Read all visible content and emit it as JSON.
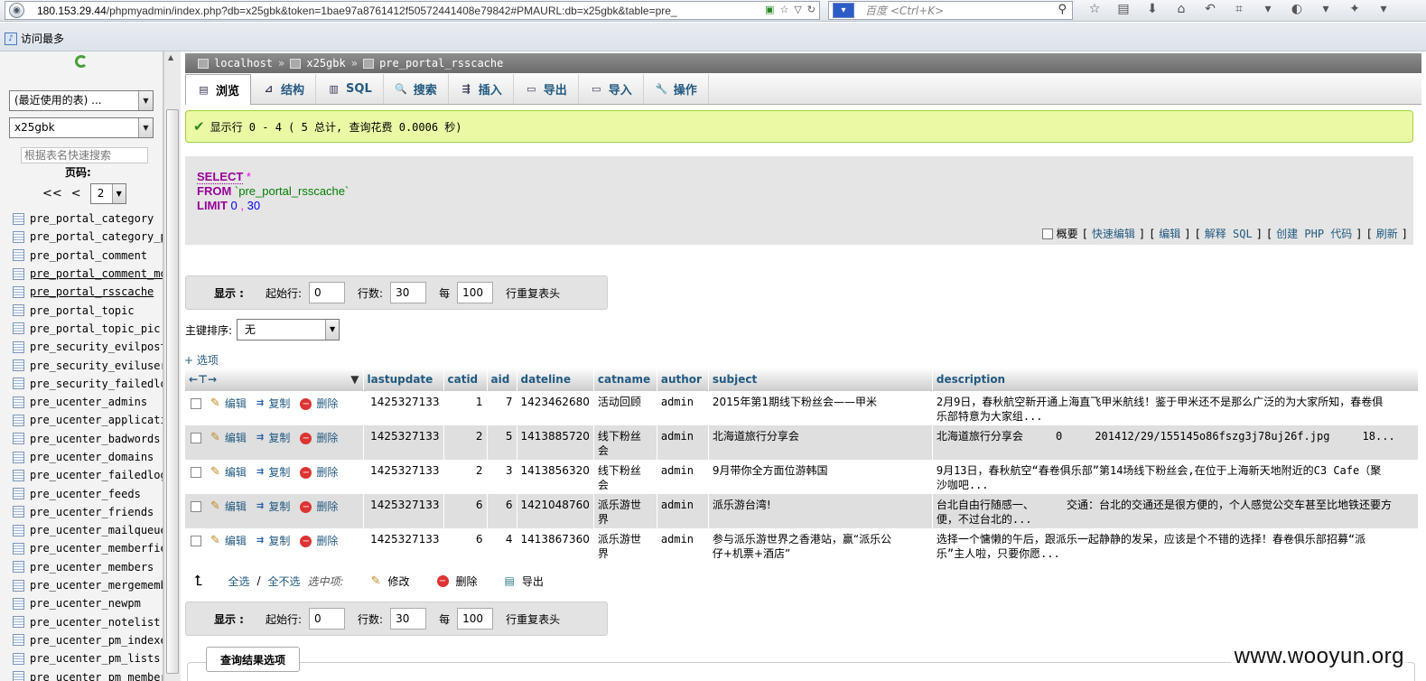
{
  "browser": {
    "url_host": "180.153.29.44",
    "url_rest": "/phpmyadmin/index.php?db=x25gbk&token=1bae97a8761412f50572441408e79842#PMAURL:db=x25gbk&table=pre_",
    "search_placeholder": "百度 <Ctrl+K>",
    "bookmark_most_visited": "访问最多"
  },
  "nav": {
    "recent_select": "(最近使用的表) ...",
    "db_select": "x25gbk",
    "filter_placeholder": "根据表名快速搜索",
    "page_label": "页码:",
    "pager_first": "<<",
    "pager_prev": "<",
    "pager_value": "2",
    "tables": [
      "pre_portal_category",
      "pre_portal_category_pe",
      "pre_portal_comment",
      "pre_portal_comment_mo",
      "pre_portal_rsscache",
      "pre_portal_topic",
      "pre_portal_topic_pic",
      "pre_security_evilpost",
      "pre_security_eviluser",
      "pre_security_failedlog",
      "pre_ucenter_admins",
      "pre_ucenter_applicatio",
      "pre_ucenter_badwords",
      "pre_ucenter_domains",
      "pre_ucenter_failedlogi",
      "pre_ucenter_feeds",
      "pre_ucenter_friends",
      "pre_ucenter_mailqueue",
      "pre_ucenter_memberfiel",
      "pre_ucenter_members",
      "pre_ucenter_mergemembe",
      "pre_ucenter_newpm",
      "pre_ucenter_notelist",
      "pre_ucenter_pm_indexe",
      "pre_ucenter_pm_lists",
      "pre_ucenter_pm_member"
    ]
  },
  "breadcrumb": {
    "server": "localhost",
    "db": "x25gbk",
    "table": "pre_portal_rsscache",
    "sep": "»"
  },
  "tabs": [
    {
      "label": "浏览",
      "icon": "▤"
    },
    {
      "label": "结构",
      "icon": "⊿"
    },
    {
      "label": "SQL",
      "icon": "▥"
    },
    {
      "label": "搜索",
      "icon": "🔍"
    },
    {
      "label": "插入",
      "icon": "⇶"
    },
    {
      "label": "导出",
      "icon": "▭"
    },
    {
      "label": "导入",
      "icon": "▭"
    },
    {
      "label": "操作",
      "icon": "🔧"
    }
  ],
  "notice": "显示行 0 - 4 ( 5 总计, 查询花费 0.0006 秒)",
  "sql": {
    "select": "SELECT",
    "star": " *",
    "from": "FROM",
    "table": " `pre_portal_rsscache`",
    "limit": "LIMIT",
    "n1": " 0",
    "comma": " ,",
    "n2": " 30"
  },
  "sql_links": {
    "profiling": "概要",
    "inline_edit": "快速编辑",
    "edit": "编辑",
    "explain": "解释 SQL",
    "php": "创建 PHP 代码",
    "refresh": "刷新"
  },
  "nav_bar": {
    "show": "显示 :",
    "start_label": "起始行:",
    "start_value": "0",
    "rows_label": "行数:",
    "rows_value": "30",
    "every_label": "每",
    "every_value": "100",
    "repeat_label": "行重复表头"
  },
  "sort": {
    "label": "主键排序:",
    "value": "无"
  },
  "options_toggle": "+ 选项",
  "columns": [
    "lastupdate",
    "catid",
    "aid",
    "dateline",
    "catname",
    "author",
    "subject",
    "description"
  ],
  "action_labels": {
    "edit": "编辑",
    "copy": "复制",
    "delete": "删除"
  },
  "rows": [
    {
      "lastupdate": "1425327133",
      "catid": "1",
      "aid": "7",
      "dateline": "1423462680",
      "catname": "活动回顾",
      "author": "admin",
      "subject": "2015年第1期线下粉丝会——甲米",
      "description": "2月9日，春秋航空新开通上海直飞甲米航线！鉴于甲米还不是那么广泛的为大家所知，春卷俱\n乐部特意为大家组..."
    },
    {
      "lastupdate": "1425327133",
      "catid": "2",
      "aid": "5",
      "dateline": "1413885720",
      "catname": "线下粉丝\n会",
      "author": "admin",
      "subject": "北海道旅行分享会",
      "description": "北海道旅行分享会     0     201412/29/155145o86fszg3j78uj26f.jpg     18..."
    },
    {
      "lastupdate": "1425327133",
      "catid": "2",
      "aid": "3",
      "dateline": "1413856320",
      "catname": "线下粉丝\n会",
      "author": "admin",
      "subject": "9月带你全方面位游韩国",
      "description": "9月13日，春秋航空“春卷俱乐部”第14场线下粉丝会,在位于上海新天地附近的C3 Cafe（聚\n沙咖吧..."
    },
    {
      "lastupdate": "1425327133",
      "catid": "6",
      "aid": "6",
      "dateline": "1421048760",
      "catname": "派乐游世\n界",
      "author": "admin",
      "subject": "派乐游台湾!",
      "description": "台北自由行随感一、     交通：台北的交通还是很方便的，个人感觉公交车甚至比地铁还要方\n便，不过台北的..."
    },
    {
      "lastupdate": "1425327133",
      "catid": "6",
      "aid": "4",
      "dateline": "1413867360",
      "catname": "派乐游世\n界",
      "author": "admin",
      "subject": "参与派乐游世界之香港站，赢“派乐公\n仔+机票+酒店”",
      "description": "选择一个慵懒的午后，跟派乐一起静静的发呆，应该是个不错的选择！春卷俱乐部招募“派\n乐”主人啦，只要你愿..."
    }
  ],
  "bulk": {
    "check_all": "全选",
    "slash": "/",
    "uncheck_all": "全不选",
    "with_selected": "选中项:",
    "change": "修改",
    "delete": "删除",
    "export": "导出"
  },
  "result_options": "查询结果选项",
  "watermark": "www.wooyun.org"
}
